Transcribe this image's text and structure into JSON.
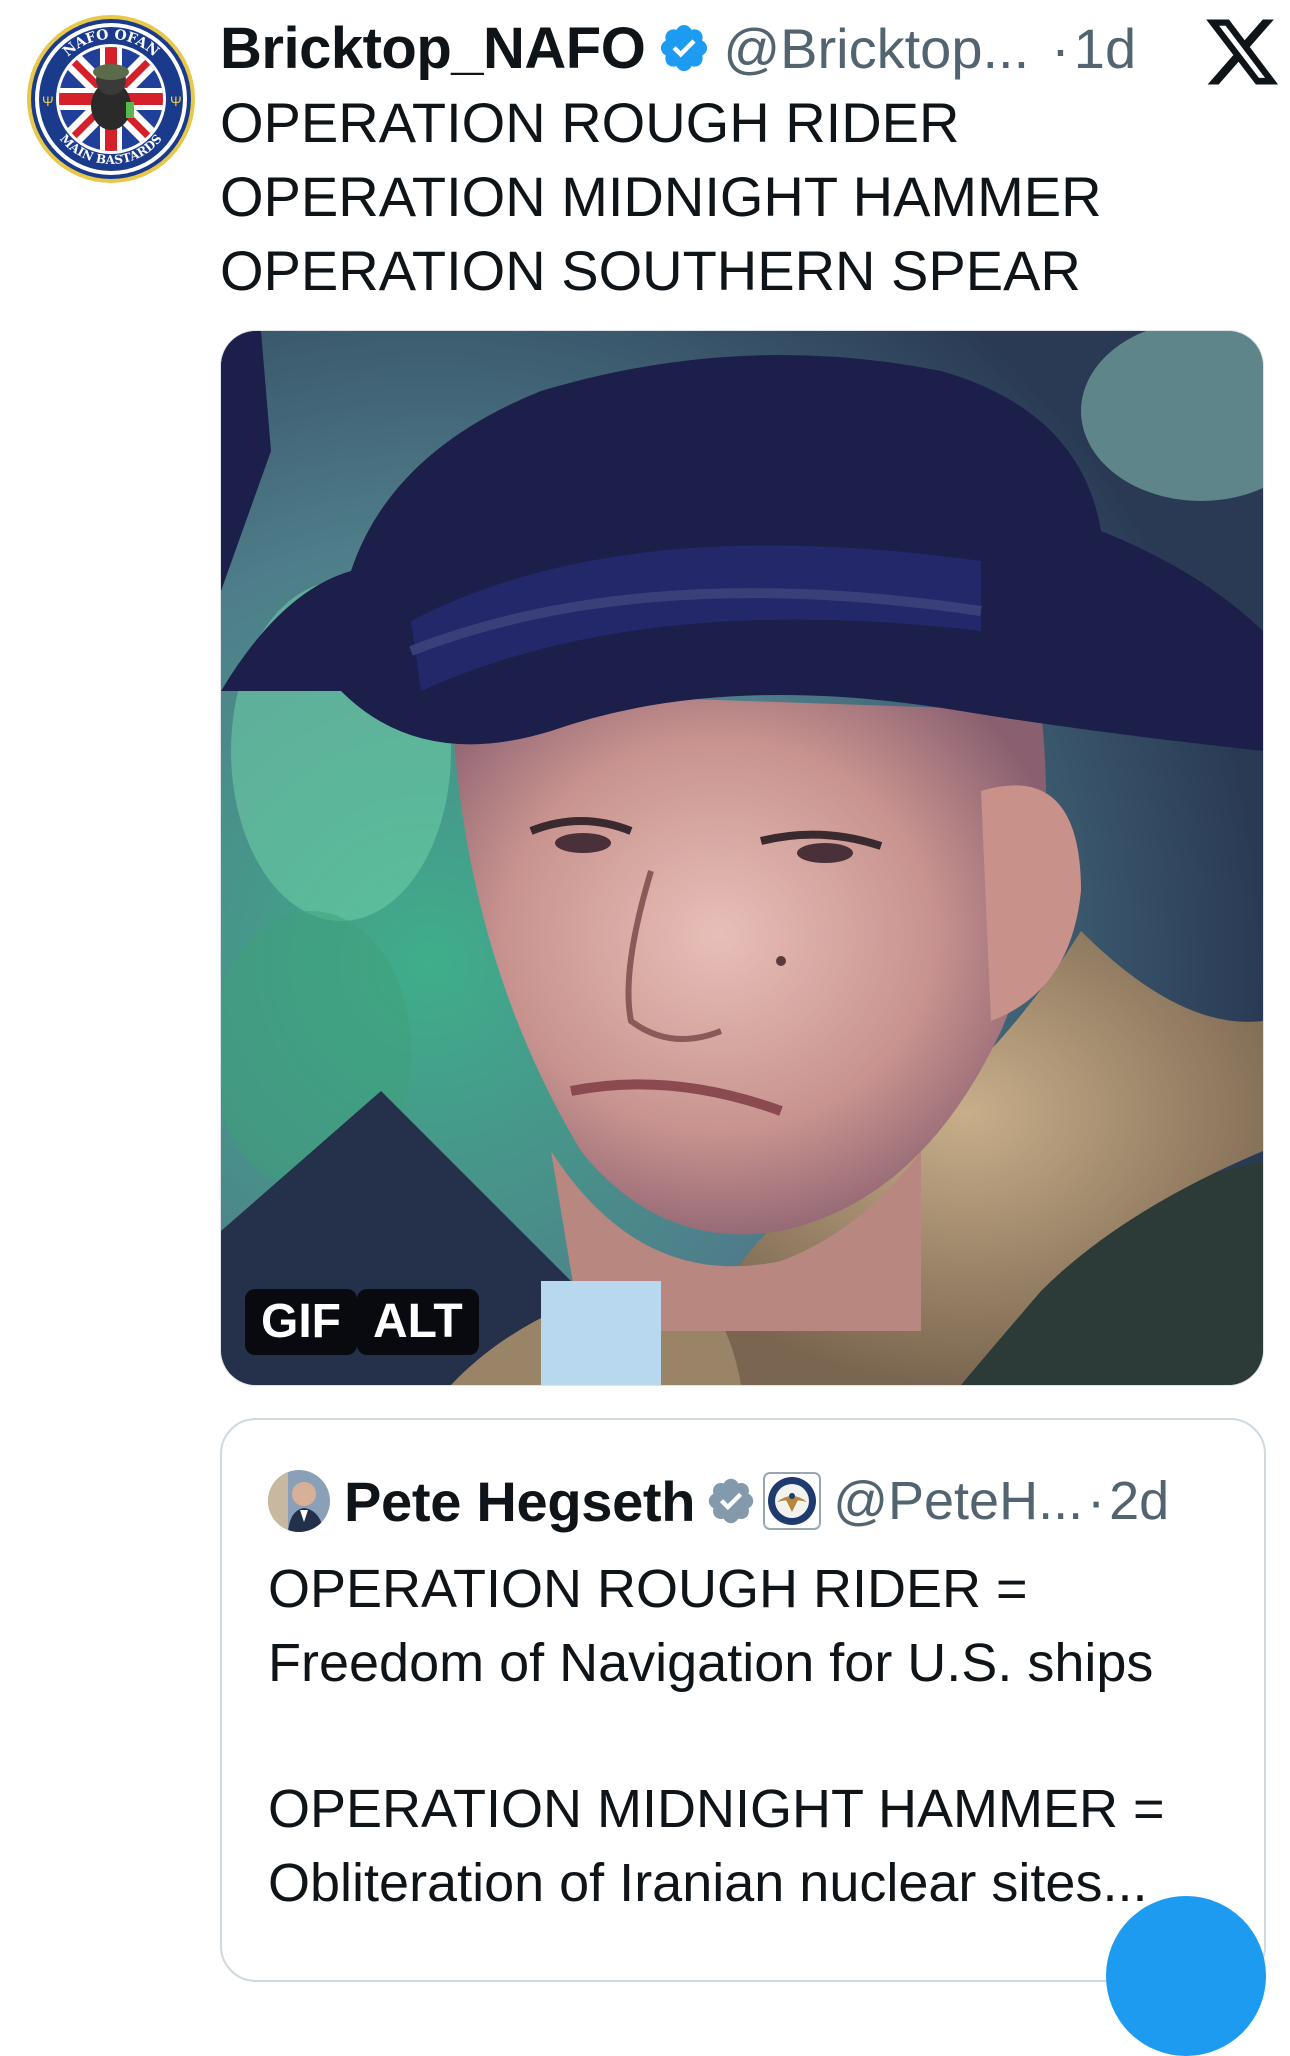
{
  "author": {
    "display_name": "Bricktop_NAFO",
    "handle": "@Bricktop...",
    "separator": "·",
    "time": "1d",
    "avatar_icon": "nafo-ofan-main-bastards-badge",
    "avatar_text": {
      "top": "NAFO OFAN",
      "bottom": "MAIN BASTARDS"
    },
    "verified_icon": "verified-badge-icon",
    "verified_color": "#1d9bf0"
  },
  "tweet": {
    "lines": [
      "OPERATION ROUGH RIDER",
      "OPERATION MIDNIGHT HAMMER",
      "OPERATION SOUTHERN SPEAR"
    ]
  },
  "media": {
    "type_badge": "GIF",
    "alt_badge": "ALT"
  },
  "quote": {
    "display_name": "Pete Hegseth",
    "handle": "@PeteH...",
    "separator": "·",
    "time": "2d",
    "verified_icon": "verified-badge-icon",
    "verified_color": "#829aab",
    "affiliation_icon": "department-seal-icon",
    "lines": [
      "OPERATION ROUGH RIDER =",
      "Freedom of Navigation for U.S. ships",
      "",
      "OPERATION MIDNIGHT HAMMER =",
      "Obliteration of Iranian nuclear sites..."
    ]
  },
  "platform": {
    "logo_icon": "x-logo-icon",
    "fab_color": "#1d9bf0"
  }
}
